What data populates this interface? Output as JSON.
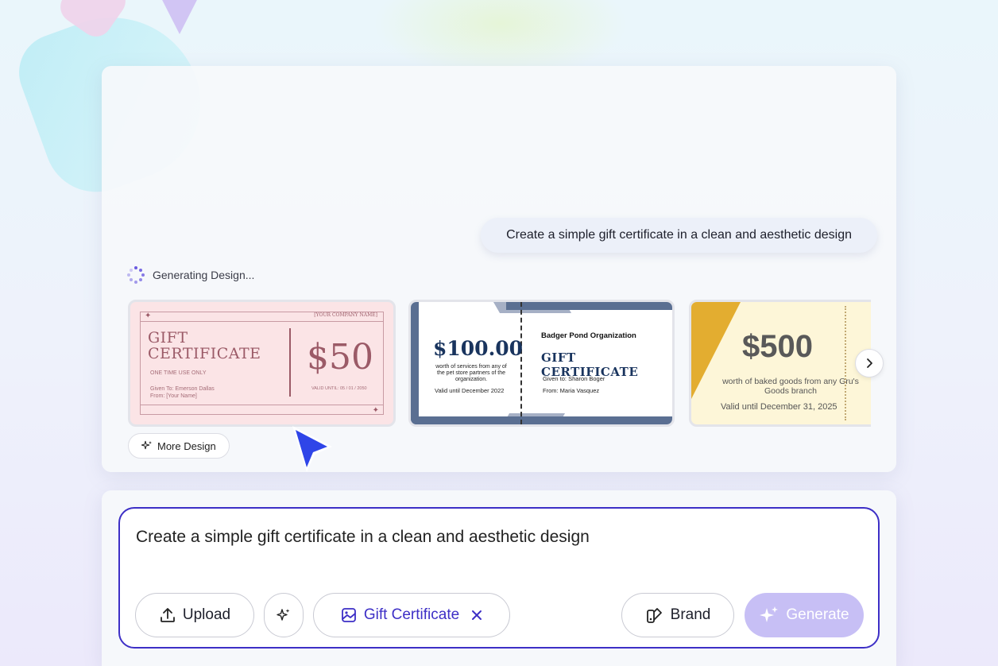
{
  "conversation": {
    "user_prompt": "Create a simple gift certificate in a clean and aesthetic design",
    "status": "Generating Design..."
  },
  "designs": [
    {
      "title_line1": "GIFT",
      "title_line2": "CERTIFICATE",
      "company": "[YOUR COMPANY NAME]",
      "one_time": "ONE TIME USE ONLY",
      "given_to": "Given To: Emerson Dallas",
      "from": "From: [Your Name]",
      "amount": "$50",
      "valid": "VALID UNTIL: 05 / 01 / 2050",
      "bg_color": "#fbe4e6",
      "accent": "#9b5a67"
    },
    {
      "amount": "$100.00",
      "description": "worth of services from any of the pet store partners of the organization.",
      "valid": "Valid until December 2022",
      "organization": "Badger Pond Organization",
      "title": "GIFT CERTIFICATE",
      "given_to": "Given to: Sharon Boger",
      "from": "From: Maria Vasquez",
      "accent": "#19345e"
    },
    {
      "amount": "$500",
      "description": "worth of baked goods from any Gru's Goods branch",
      "valid": "Valid until December 31, 2025",
      "bg_color": "#fdf6d8",
      "accent": "#e3ad30"
    }
  ],
  "more_design_label": "More Design",
  "composer": {
    "input_value": "Create a simple gift certificate in a clean and aesthetic design",
    "upload_label": "Upload",
    "tag_label": "Gift Certificate",
    "brand_label": "Brand",
    "generate_label": "Generate",
    "accent": "#3d2fc6"
  }
}
